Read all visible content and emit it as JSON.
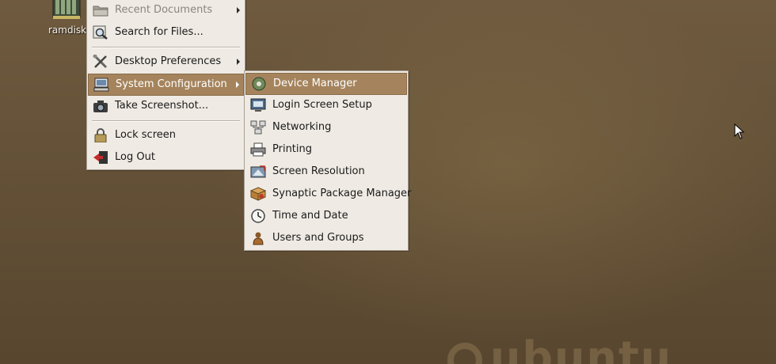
{
  "desktop": {
    "icon_label": "ramdisk",
    "watermark_text": "ubuntu"
  },
  "main_menu": {
    "items": [
      {
        "label": "Recent Documents",
        "icon": "folder-icon",
        "submenu": true,
        "dimmed": true
      },
      {
        "label": "Search for Files...",
        "icon": "search-files-icon",
        "submenu": false
      },
      {
        "label": "Desktop Preferences",
        "icon": "tools-icon",
        "submenu": true
      },
      {
        "label": "System Configuration",
        "icon": "computer-icon",
        "submenu": true,
        "highlighted": true
      },
      {
        "label": "Take Screenshot...",
        "icon": "camera-icon",
        "submenu": false
      },
      {
        "label": "Lock screen",
        "icon": "lock-icon",
        "submenu": false
      },
      {
        "label": "Log Out",
        "icon": "logout-icon",
        "submenu": false
      }
    ]
  },
  "system_configuration_menu": {
    "items": [
      {
        "label": "Device Manager",
        "icon": "device-manager-icon",
        "highlighted": true
      },
      {
        "label": "Login Screen Setup",
        "icon": "login-screen-icon"
      },
      {
        "label": "Networking",
        "icon": "network-icon"
      },
      {
        "label": "Printing",
        "icon": "printer-icon"
      },
      {
        "label": "Screen Resolution",
        "icon": "display-icon"
      },
      {
        "label": "Synaptic Package Manager",
        "icon": "package-icon"
      },
      {
        "label": "Time and Date",
        "icon": "clock-icon"
      },
      {
        "label": "Users and Groups",
        "icon": "users-icon"
      }
    ]
  },
  "colors": {
    "highlight": "#a5845d",
    "menu_bg": "#efebe4",
    "desktop_bg": "#655238"
  }
}
